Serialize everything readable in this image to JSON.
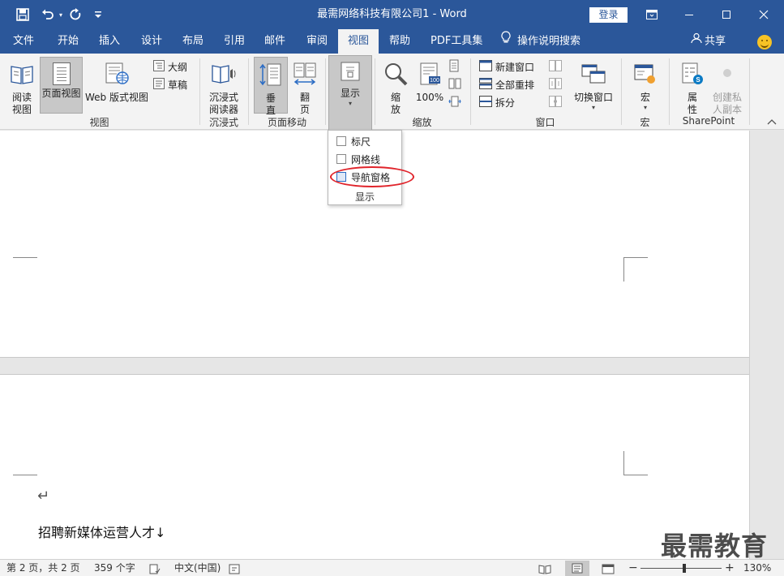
{
  "window": {
    "title": "最需网络科技有限公司1 - Word",
    "login_label": "登录"
  },
  "tabs": [
    {
      "label": "文件"
    },
    {
      "label": "开始"
    },
    {
      "label": "插入"
    },
    {
      "label": "设计"
    },
    {
      "label": "布局"
    },
    {
      "label": "引用"
    },
    {
      "label": "邮件"
    },
    {
      "label": "审阅"
    },
    {
      "label": "视图"
    },
    {
      "label": "帮助"
    },
    {
      "label": "PDF工具集"
    },
    {
      "label": "操作说明搜索"
    }
  ],
  "share_label": "共享",
  "ribbon": {
    "views": {
      "read_mode": "阅读\n视图",
      "print_layout": "页面视图",
      "web_layout": "Web 版式视图",
      "outline": "大纲",
      "draft": "草稿",
      "group": "视图"
    },
    "immersive": {
      "reader": "沉浸式\n阅读器",
      "group": "沉浸式"
    },
    "page_movement": {
      "vertical": "垂\n直",
      "side_to_side": "翻\n页",
      "group": "页面移动"
    },
    "show": {
      "label": "显示"
    },
    "zoom": {
      "zoom": "缩\n放",
      "percent": "100%",
      "group": "缩放"
    },
    "window": {
      "new_window": "新建窗口",
      "arrange_all": "全部重排",
      "split": "拆分",
      "switch_windows": "切换窗口",
      "group": "窗口"
    },
    "macros": {
      "macros": "宏",
      "group": "宏"
    },
    "sharepoint": {
      "properties": "属\n性",
      "private_copy": "创建私\n人副本",
      "group": "SharePoint"
    }
  },
  "show_dropdown": {
    "items": [
      {
        "label": "标尺",
        "checked": false
      },
      {
        "label": "网格线",
        "checked": false
      },
      {
        "label": "导航窗格",
        "checked": false
      }
    ],
    "footer": "显示"
  },
  "document": {
    "text": "招聘新媒体运营人才↓"
  },
  "statusbar": {
    "page": "第 2 页，共 2 页",
    "words": "359 个字",
    "language": "中文(中国)",
    "zoom_percent": "130%"
  },
  "watermark": "最需教育",
  "colors": {
    "accent": "#2b579a",
    "highlight_circle": "#e0242b"
  }
}
